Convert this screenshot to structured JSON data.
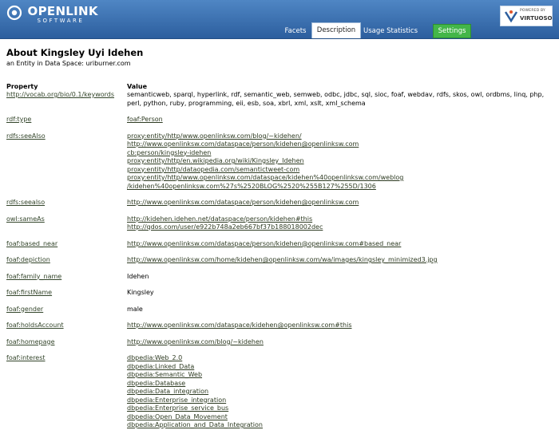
{
  "header": {
    "logo_name": "OPENLINK",
    "logo_sub": "SOFTWARE",
    "badge_powered": "POWERED BY",
    "badge_brand": "VIRTUOSO",
    "tabs": [
      {
        "label": "Facets",
        "active": false
      },
      {
        "label": "Description",
        "active": true
      },
      {
        "label": "Usage Statistics",
        "active": false
      },
      {
        "label": "Settings",
        "active": false
      }
    ]
  },
  "page": {
    "about_prefix": "About",
    "title": "Kingsley Uyi Idehen",
    "entity_prefix": "an Entity in Data Space:",
    "data_space": "uriburner.com"
  },
  "table": {
    "property_header": "Property",
    "value_header": "Value",
    "rows": [
      {
        "property": "http://vocab.org/bio/0.1/keywords",
        "values": [
          "semanticweb, sparql, hyperlink, rdf, semantic_web, semweb, odbc, jdbc, sql, sioc, foaf, webdav, rdfs, skos, owl, ordbms, linq, php, perl, python, ruby, programming, eii, esb, soa, xbrl, xml, xslt, xml_schema"
        ],
        "link": false
      },
      {
        "property": "rdf:type",
        "values": [
          "foaf:Person"
        ],
        "link": true
      },
      {
        "property": "rdfs:seeAlso",
        "values": [
          "proxy:entity/http/www.openlinksw.com/blog/~kidehen/",
          "http://www.openlinksw.com/dataspace/person/kidehen@openlinksw.com",
          "cb:person/kingsley-idehen",
          "proxy:entity/http/en.wikipedia.org/wiki/Kingsley_Idehen",
          "proxy:entity/http/dataopedia.com/semantictweet-com",
          "proxy:entity/http/www.openlinksw.com/dataspace/kidehen%40openlinksw.com/weblog",
          "/kidehen%40openlinksw.com%27s%2520BLOG%2520%255B127%255D/1306"
        ],
        "link": true
      },
      {
        "property": "rdfs:seealso",
        "values": [
          "http://www.openlinksw.com/dataspace/person/kidehen@openlinksw.com"
        ],
        "link": true
      },
      {
        "property": "owl:sameAs",
        "values": [
          "http://kidehen.idehen.net/dataspace/person/kidehen#this",
          "http://qdos.com/user/e922b748a2eb667bf37b188018002dec"
        ],
        "link": true
      },
      {
        "property": "foaf:based_near",
        "values": [
          "http://www.openlinksw.com/dataspace/person/kidehen@openlinksw.com#based_near"
        ],
        "link": true
      },
      {
        "property": "foaf:depiction",
        "values": [
          "http://www.openlinksw.com/home/kidehen@openlinksw.com/wa/images/kingsley_minimized3.jpg"
        ],
        "link": true
      },
      {
        "property": "foaf:family_name",
        "values": [
          "Idehen"
        ],
        "link": false
      },
      {
        "property": "foaf:firstName",
        "values": [
          "Kingsley"
        ],
        "link": false
      },
      {
        "property": "foaf:gender",
        "values": [
          "male"
        ],
        "link": false
      },
      {
        "property": "foaf:holdsAccount",
        "values": [
          "http://www.openlinksw.com/dataspace/kidehen@openlinksw.com#this"
        ],
        "link": true
      },
      {
        "property": "foaf:homepage",
        "values": [
          "http://www.openlinksw.com/blog/~kidehen"
        ],
        "link": true
      },
      {
        "property": "foaf:interest",
        "values": [
          "dbpedia:Web_2.0",
          "dbpedia:Linked_Data",
          "dbpedia:Semantic_Web",
          "dbpedia:Database",
          "dbpedia:Data_integration",
          "dbpedia:Enterprise_integration",
          "dbpedia:Enterprise_service_bus",
          "dbpedia:Open_Data_Movement",
          "dbpedia:Application_and_Data_Integration"
        ],
        "link": true
      }
    ]
  }
}
